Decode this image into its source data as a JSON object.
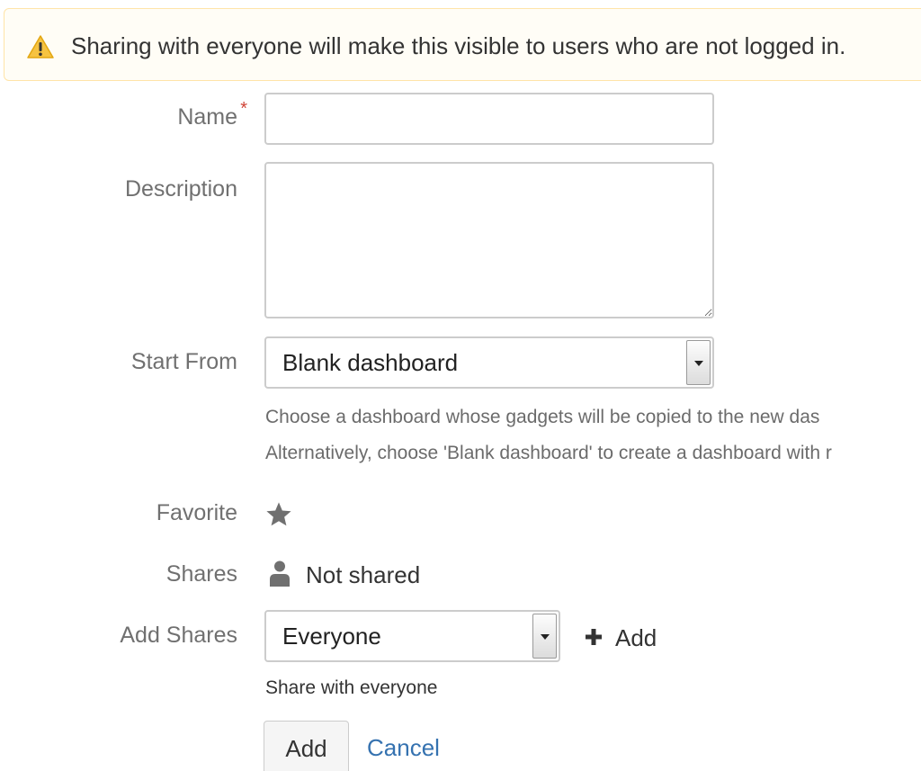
{
  "warning": {
    "text": "Sharing with everyone will make this visible to users who are not logged in.",
    "icon": "warning-icon",
    "color": "#f6c342"
  },
  "form": {
    "name_label": "Name",
    "name_required_mark": "*",
    "name_value": "",
    "description_label": "Description",
    "description_value": "",
    "start_from_label": "Start From",
    "start_from_selected": "Blank dashboard",
    "start_from_help_line1": "Choose a dashboard whose gadgets will be copied to the new das",
    "start_from_help_line2": "Alternatively, choose 'Blank dashboard' to create a dashboard with r",
    "favorite_label": "Favorite",
    "favorite_icon": "star-icon",
    "shares_label": "Shares",
    "shares_icon": "user-icon",
    "shares_value": "Not shared",
    "add_shares_label": "Add Shares",
    "add_shares_selected": "Everyone",
    "add_share_link": "Add",
    "add_shares_help": "Share with everyone"
  },
  "actions": {
    "add_button": "Add",
    "cancel_link": "Cancel"
  },
  "colors": {
    "required": "#d04437",
    "link": "#3572b0",
    "warning_bg": "#fffdf6",
    "warning_border": "#ffe4a8"
  }
}
